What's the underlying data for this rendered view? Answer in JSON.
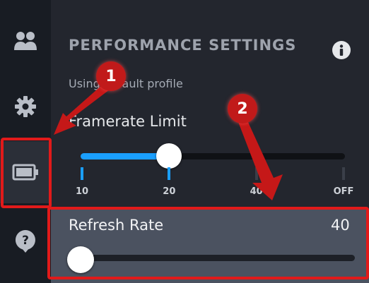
{
  "panel": {
    "title": "PERFORMANCE SETTINGS",
    "subtitle": "Using default profile"
  },
  "sidebar": {
    "items": [
      {
        "icon": "friends-icon"
      },
      {
        "icon": "gear-icon"
      },
      {
        "icon": "battery-icon",
        "active": true
      },
      {
        "icon": "help-icon"
      }
    ]
  },
  "framerate": {
    "label": "Framerate Limit",
    "ticks": [
      "10",
      "20",
      "40",
      "OFF"
    ],
    "selected_index": 1
  },
  "refresh": {
    "label": "Refresh Rate",
    "value": "40",
    "slider_fraction": 0
  },
  "annotations": {
    "badge_1": "1",
    "badge_2": "2"
  },
  "colors": {
    "accent": "#1a9fff",
    "highlight": "#e11a1a",
    "badge": "#c11a1a"
  }
}
